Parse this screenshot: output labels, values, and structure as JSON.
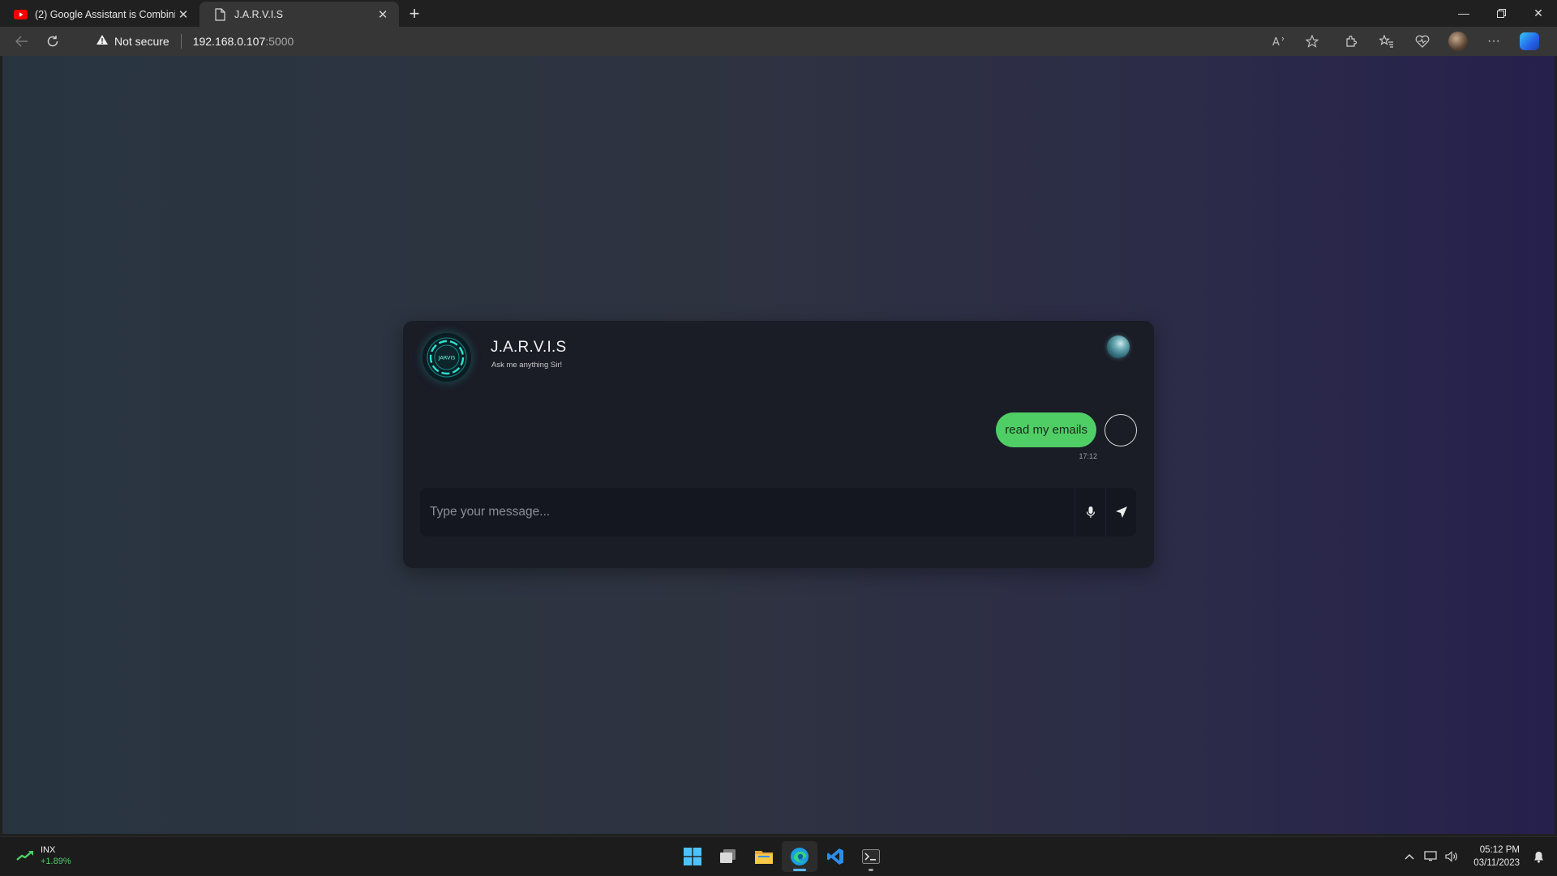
{
  "browser": {
    "tabs": [
      {
        "title": "(2) Google Assistant is Combining",
        "icon": "youtube-icon",
        "active": false
      },
      {
        "title": "J.A.R.V.I.S",
        "icon": "page-icon",
        "active": true
      }
    ],
    "address": {
      "security_label": "Not secure",
      "url_host": "192.168.0.107",
      "url_port": ":5000"
    }
  },
  "chat": {
    "bot_name": "J.A.R.V.I.S",
    "bot_tagline": "Ask me anything Sir!",
    "avatar_text": "JARVIS",
    "messages": [
      {
        "sender": "user",
        "text": "read my emails",
        "time": "17:12"
      }
    ],
    "composer": {
      "placeholder": "Type your message...",
      "value": ""
    },
    "colors": {
      "user_bubble": "#4fce65",
      "card_bg": "#1a1c26"
    }
  },
  "taskbar": {
    "widget": {
      "label": "INX",
      "change": "+1.89%"
    },
    "apps": [
      "start-icon",
      "task-view-icon",
      "file-explorer-icon",
      "edge-icon",
      "vscode-icon",
      "terminal-icon"
    ],
    "clock": {
      "time": "05:12 PM",
      "date": "03/11/2023"
    }
  }
}
